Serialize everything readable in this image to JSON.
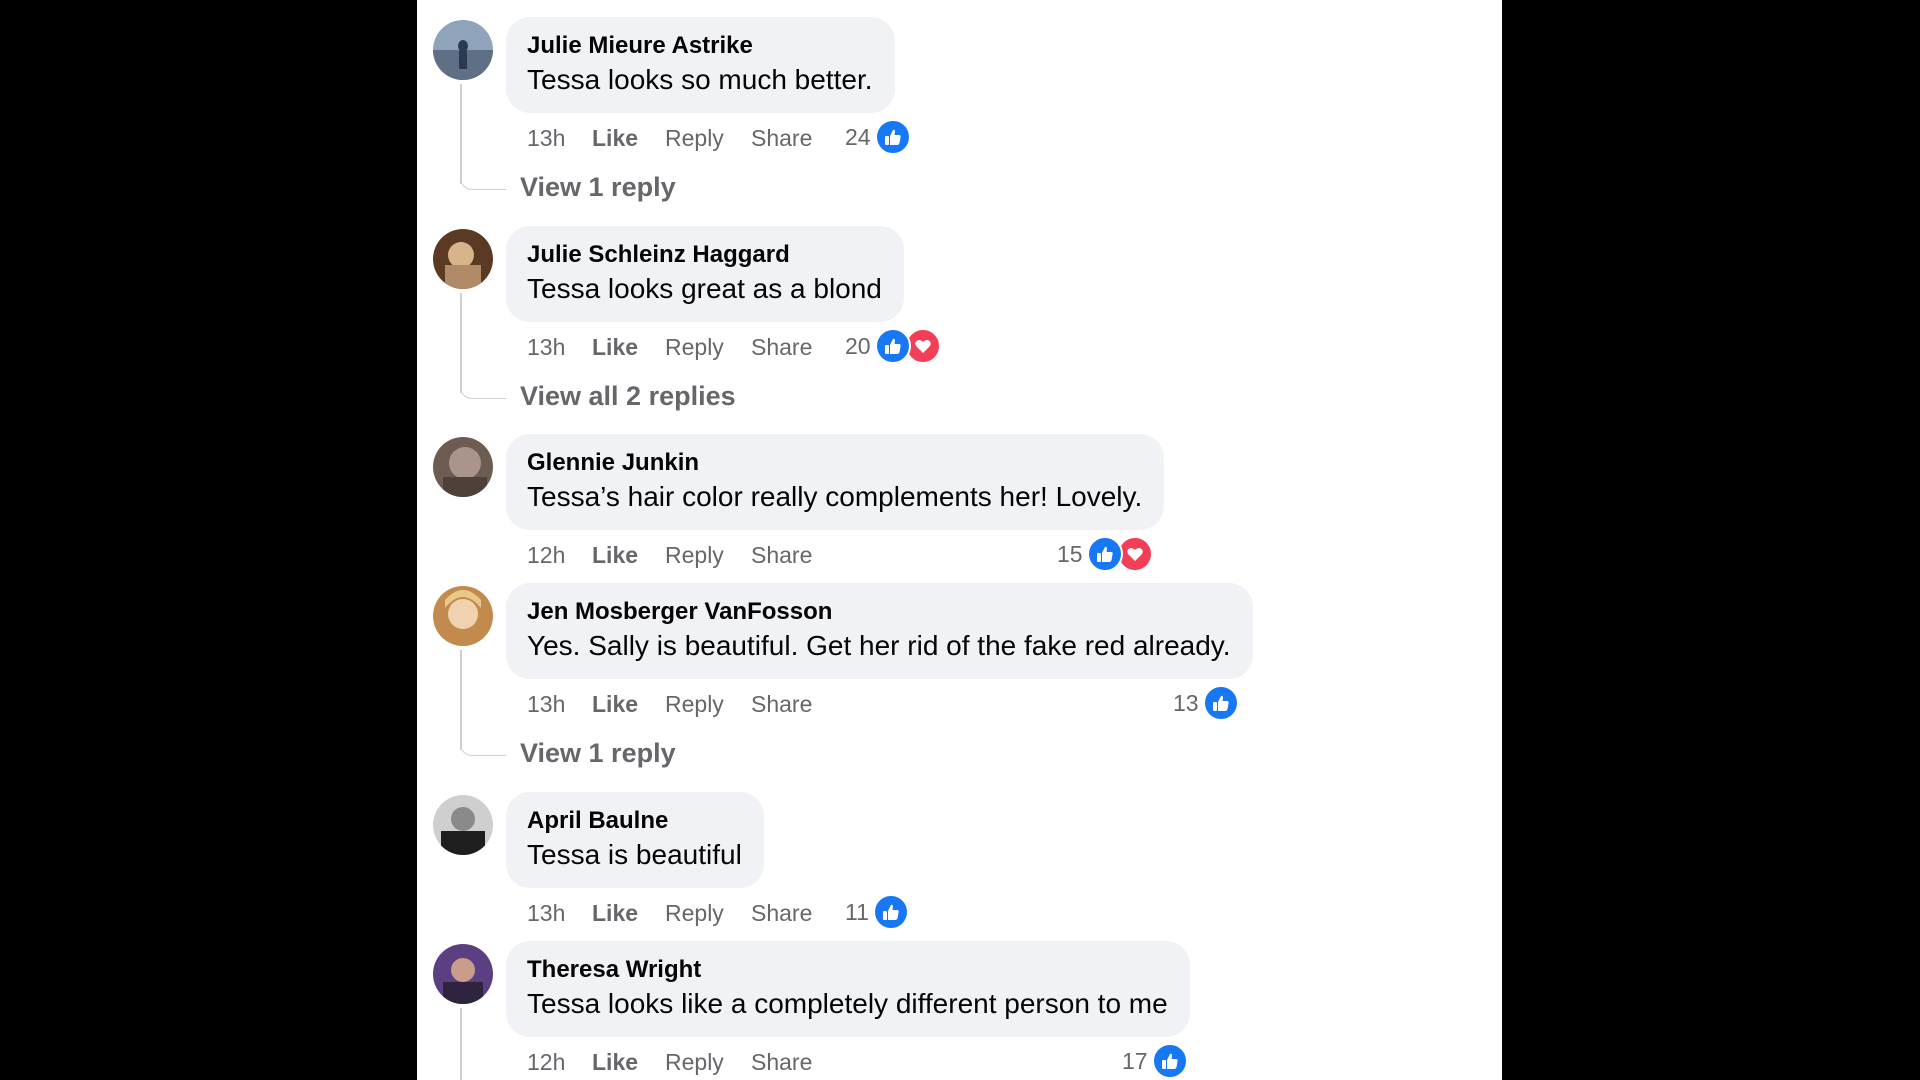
{
  "comments": [
    {
      "author": "Julie Mieure Astrike",
      "text": "Tessa looks so much better.",
      "time": "13h",
      "like": "Like",
      "reply": "Reply",
      "share": "Share",
      "reaction_count": "24",
      "reactions": [
        "like-icon"
      ],
      "view_replies": "View 1 reply",
      "avatar_color": "#7b8ea6"
    },
    {
      "author": "Julie Schleinz Haggard",
      "text": "Tessa looks great as a blond",
      "time": "13h",
      "like": "Like",
      "reply": "Reply",
      "share": "Share",
      "reaction_count": "20",
      "reactions": [
        "like-icon",
        "love-icon"
      ],
      "view_replies": "View all 2 replies",
      "avatar_color": "#8a5a33"
    },
    {
      "author": "Glennie Junkin",
      "text": "Tessa’s hair color really complements her! Lovely.",
      "time": "12h",
      "like": "Like",
      "reply": "Reply",
      "share": "Share",
      "reaction_count": "15",
      "reactions": [
        "like-icon",
        "love-icon"
      ],
      "view_replies": "",
      "avatar_color": "#8f7f74"
    },
    {
      "author": "Jen Mosberger VanFosson",
      "text": "Yes. Sally is beautiful. Get her rid of the fake red already.",
      "time": "13h",
      "like": "Like",
      "reply": "Reply",
      "share": "Share",
      "reaction_count": "13",
      "reactions": [
        "like-icon"
      ],
      "view_replies": "View 1 reply",
      "avatar_color": "#d2a46a"
    },
    {
      "author": "April Baulne",
      "text": "Tessa is beautiful",
      "time": "13h",
      "like": "Like",
      "reply": "Reply",
      "share": "Share",
      "reaction_count": "11",
      "reactions": [
        "like-icon"
      ],
      "view_replies": "",
      "avatar_color": "#3a3a3a"
    },
    {
      "author": "Theresa Wright",
      "text": "Tessa looks like a completely different person to me",
      "time": "12h",
      "like": "Like",
      "reply": "Reply",
      "share": "Share",
      "reaction_count": "17",
      "reactions": [
        "like-icon"
      ],
      "view_replies": "",
      "avatar_color": "#5a3f7a"
    }
  ],
  "colors": {
    "like_blue": "#1877f2",
    "love_red": "#f33e58",
    "bubble_bg": "#f0f2f5",
    "muted_text": "#65676b"
  }
}
